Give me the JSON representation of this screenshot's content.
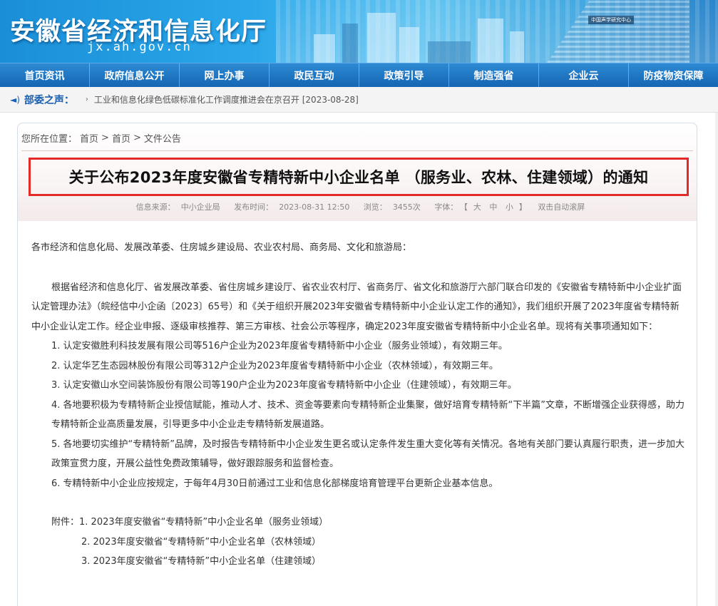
{
  "header": {
    "site_title": "安徽省经济和信息化厅",
    "site_domain": "jx.ah.gov.cn",
    "banner_label": "中国声学研究中心"
  },
  "nav": {
    "items": [
      "首页资讯",
      "政府信息公开",
      "网上办事",
      "政民互动",
      "政策引导",
      "制造强省",
      "企业云",
      "防疫物资保障"
    ]
  },
  "ticker": {
    "label": "部委之声：",
    "arrow": "›",
    "text": "工业和信息化绿色低碳标准化工作调度推进会在京召开 [2023-08-28]"
  },
  "breadcrumb": {
    "prefix": "您所在位置：",
    "items": [
      "首页",
      "首页",
      "文件公告"
    ],
    "sep": ">"
  },
  "article": {
    "title": "关于公布2023年度安徽省专精特新中小企业名单 （服务业、农林、住建领域）的通知",
    "meta": {
      "source_label": "信息来源：",
      "source": "中小企业局",
      "time_label": "发布时间：",
      "time": "2023-08-31 12:50",
      "views_label": "浏览：",
      "views": "3455次",
      "font_label": "字体：",
      "font_open": "【",
      "font_big": "大",
      "font_mid": "中",
      "font_small": "小",
      "font_close": "】",
      "scroll": "双击自动滚屏"
    },
    "salutation": "各市经济和信息化局、发展改革委、住房城乡建设局、农业农村局、商务局、文化和旅游局：",
    "intro": "根据省经济和信息化厅、省发展改革委、省住房城乡建设厅、省农业农村厅、省商务厅、省文化和旅游厅六部门联合印发的《安徽省专精特新中小企业扩面认定管理办法》（皖经信中小企函〔2023〕65号）和《关于组织开展2023年安徽省专精特新中小企业认定工作的通知》，我们组织开展了2023年度省专精特新中小企业认定工作。经企业申报、逐级审核推荐、第三方审核、社会公示等程序，确定2023年度安徽省专精特新中小企业名单。现将有关事项通知如下：",
    "items": [
      "1. 认定安徽胜利科技发展有限公司等516户企业为2023年度省专精特新中小企业（服务业领域），有效期三年。",
      "2. 认定华艺生态园林股份有限公司等312户企业为2023年度省专精特新中小企业（农林领域），有效期三年。",
      "3. 认定安徽山水空间装饰股份有限公司等190户企业为2023年度省专精特新中小企业（住建领域），有效期三年。",
      "4. 各地要积极为专精特新企业授信赋能，推动人才、技术、资金等要素向专精特新企业集聚，做好培育专精特新“下半篇”文章，不断增强企业获得感，助力专精特新企业高质量发展，引导更多中小企业走专精特新发展道路。",
      "5. 各地要切实维护“专精特新”品牌，及时报告专精特新中小企业发生更名或认定条件发生重大变化等有关情况。各地有关部门要认真履行职责，进一步加大政策宣贯力度，开展公益性免费政策辅导，做好跟踪服务和监督检查。",
      "6. 专精特新中小企业应按规定，于每年4月30日前通过工业和信息化部梯度培育管理平台更新企业基本信息。"
    ],
    "attachments_label": "附件：",
    "attachments": [
      "1. 2023年度安徽省“专精特新”中小企业名单（服务业领域）",
      "2. 2023年度安徽省“专精特新”中小企业名单（农林领域）",
      "3. 2023年度安徽省“专精特新”中小企业名单（住建领域）"
    ]
  },
  "colors": {
    "nav_bg": "#1565b3",
    "title_border": "#e32a2a",
    "ticker_label": "#1a5fb0"
  }
}
